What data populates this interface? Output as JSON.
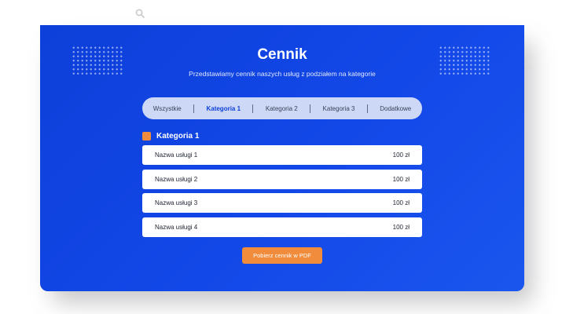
{
  "icons": {
    "top_search": "search-icon"
  },
  "colors": {
    "panel_blue": "#1348e8",
    "accent_orange": "#f08c3c",
    "tabs_bg": "#ccd8f6",
    "active_tab": "#0d3fd9"
  },
  "pricing": {
    "title": "Cennik",
    "subtitle": "Przedstawiamy cennik naszych usług z podziałem na kategorie",
    "tabs": [
      {
        "label": "Wszystkie",
        "active": false
      },
      {
        "label": "Kategoria 1",
        "active": true
      },
      {
        "label": "Kategoria 2",
        "active": false
      },
      {
        "label": "Kategoria 3",
        "active": false
      },
      {
        "label": "Dodatkowe",
        "active": false
      }
    ],
    "category": {
      "title": "Kategoria 1",
      "items": [
        {
          "name": "Nazwa usługi 1",
          "price": "100 zł"
        },
        {
          "name": "Nazwa usługi 2",
          "price": "100 zł"
        },
        {
          "name": "Nazwa usługi 3",
          "price": "100 zł"
        },
        {
          "name": "Nazwa usługi 4",
          "price": "100 zł"
        }
      ]
    },
    "download_button": "Pobierz cennik w PDF"
  }
}
